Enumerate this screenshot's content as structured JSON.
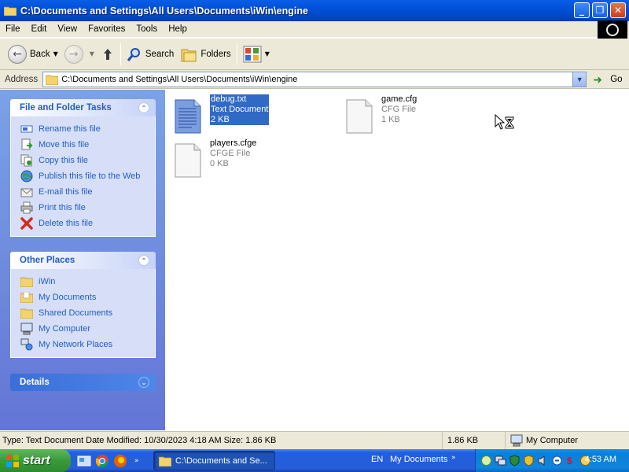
{
  "window": {
    "title": "C:\\Documents and Settings\\All Users\\Documents\\iWin\\engine",
    "buttons": {
      "minimize": "_",
      "maximize": "❐",
      "close": "✕"
    }
  },
  "menu": [
    "File",
    "Edit",
    "View",
    "Favorites",
    "Tools",
    "Help"
  ],
  "toolbar": {
    "back_label": "Back",
    "search_label": "Search",
    "folders_label": "Folders"
  },
  "address": {
    "label": "Address",
    "value": "C:\\Documents and Settings\\All Users\\Documents\\iWin\\engine",
    "go_label": "Go"
  },
  "tasks_panel": {
    "title": "File and Folder Tasks",
    "items": [
      {
        "label": "Rename this file",
        "icon": "rename-icon"
      },
      {
        "label": "Move this file",
        "icon": "move-icon"
      },
      {
        "label": "Copy this file",
        "icon": "copy-icon"
      },
      {
        "label": "Publish this file to the Web",
        "icon": "globe-icon"
      },
      {
        "label": "E-mail this file",
        "icon": "email-icon"
      },
      {
        "label": "Print this file",
        "icon": "printer-icon"
      },
      {
        "label": "Delete this file",
        "icon": "delete-icon"
      }
    ]
  },
  "places_panel": {
    "title": "Other Places",
    "items": [
      {
        "label": "iWin",
        "icon": "folder-icon"
      },
      {
        "label": "My Documents",
        "icon": "my-documents-icon"
      },
      {
        "label": "Shared Documents",
        "icon": "folder-icon"
      },
      {
        "label": "My Computer",
        "icon": "my-computer-icon"
      },
      {
        "label": "My Network Places",
        "icon": "network-icon"
      }
    ]
  },
  "details_panel": {
    "title": "Details"
  },
  "files": [
    {
      "name": "debug.txt",
      "type": "Text Document",
      "size": "2 KB",
      "selected": true
    },
    {
      "name": "game.cfg",
      "type": "CFG File",
      "size": "1 KB",
      "selected": false
    },
    {
      "name": "players.cfge",
      "type": "CFGE File",
      "size": "0 KB",
      "selected": false
    }
  ],
  "status": {
    "details": "Type: Text Document Date Modified: 10/30/2023 4:18 AM Size: 1.86 KB",
    "size": "1.86 KB",
    "zone": "My Computer"
  },
  "taskbar": {
    "start_label": "start",
    "task_label": "C:\\Documents and Se...",
    "language": "EN",
    "toolbar_label": "My Documents",
    "clock": "4:53 AM"
  },
  "colors": {
    "titlebar": "#0050d8",
    "selection": "#316ac5",
    "task_link": "#215dc6",
    "start_green": "#3a9a3a"
  }
}
